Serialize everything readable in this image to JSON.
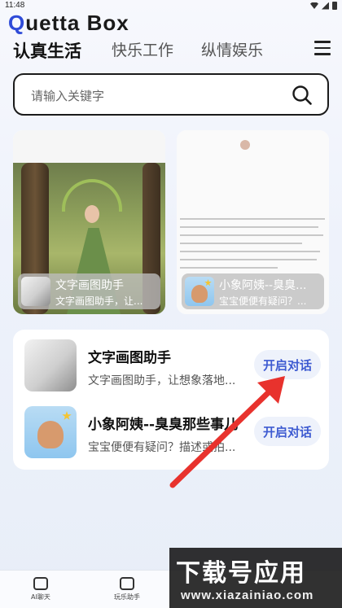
{
  "status_bar": {
    "time": "11:48"
  },
  "app": {
    "logo_q": "Q",
    "logo_rest": "uetta Box"
  },
  "tabs": [
    {
      "label": "认真生活",
      "active": true
    },
    {
      "label": "快乐工作",
      "active": false
    },
    {
      "label": "纵情娱乐",
      "active": false
    }
  ],
  "search": {
    "placeholder": "请输入关键字"
  },
  "featured": [
    {
      "title": "文字画图助手",
      "subtitle": "文字画图助手，让..."
    },
    {
      "title": "小象阿姨--臭臭...",
      "subtitle": "宝宝便便有疑问？..."
    }
  ],
  "list": [
    {
      "title": "文字画图助手",
      "subtitle": "文字画图助手，让想象落地...",
      "button": "开启对话"
    },
    {
      "title": "小象阿姨--臭臭那些事儿",
      "subtitle": "宝宝便便有疑问？描述或拍...",
      "button": "开启对话"
    }
  ],
  "bottom_nav": [
    {
      "label": "AI聊天"
    },
    {
      "label": "玩乐助手"
    }
  ],
  "watermark": {
    "line1": "下载号应用",
    "line2": "www.xiazainiao.com"
  },
  "colors": {
    "accent": "#3e5bd1",
    "logo_q": "#2f4bd8",
    "arrow": "#e8322d"
  }
}
